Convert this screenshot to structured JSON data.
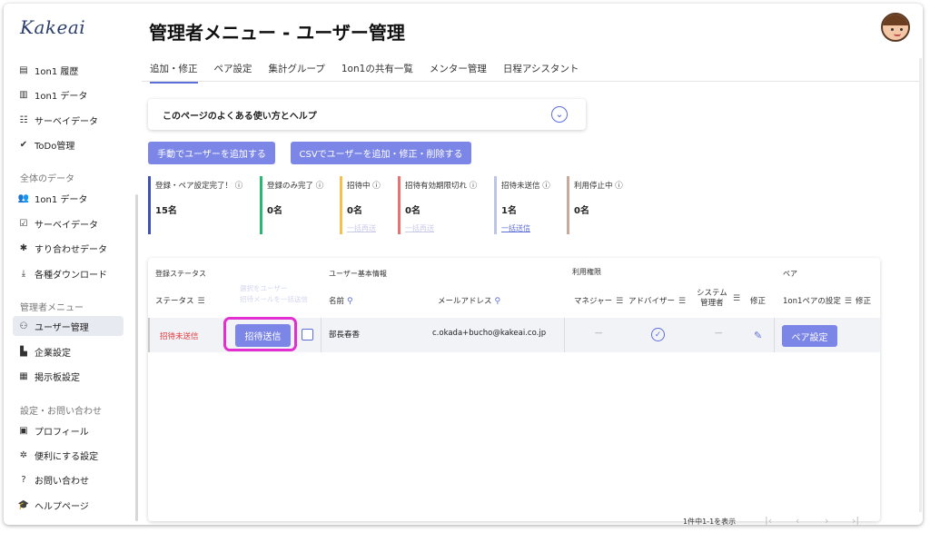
{
  "app": {
    "logo": "Kakeai"
  },
  "sidebar": {
    "items_top": [
      {
        "label": "1on1 履歴",
        "icon": "history-icon"
      },
      {
        "label": "1on1 データ",
        "icon": "chart-icon"
      },
      {
        "label": "サーベイデータ",
        "icon": "survey-icon"
      },
      {
        "label": "ToDo管理",
        "icon": "check-circle-icon"
      }
    ],
    "section_all": "全体のデータ",
    "items_all": [
      {
        "label": "1on1 データ",
        "icon": "people-icon"
      },
      {
        "label": "サーベイデータ",
        "icon": "calendar-check-icon"
      },
      {
        "label": "すり合わせデータ",
        "icon": "puzzle-icon"
      },
      {
        "label": "各種ダウンロード",
        "icon": "download-icon"
      }
    ],
    "section_admin": "管理者メニュー",
    "items_admin": [
      {
        "label": "ユーザー管理",
        "icon": "user-manage-icon",
        "active": true
      },
      {
        "label": "企業設定",
        "icon": "building-icon"
      },
      {
        "label": "掲示板設定",
        "icon": "board-icon"
      }
    ],
    "section_settings": "設定・お問い合わせ",
    "items_settings": [
      {
        "label": "プロフィール",
        "icon": "profile-icon"
      },
      {
        "label": "便利にする設定",
        "icon": "gear-icon"
      },
      {
        "label": "お問い合わせ",
        "icon": "question-icon"
      },
      {
        "label": "ヘルプページ",
        "icon": "graduation-cap-icon"
      }
    ]
  },
  "header": {
    "title": "管理者メニュー - ユーザー管理"
  },
  "tabs": [
    "追加・修正",
    "ペア設定",
    "集計グループ",
    "1on1の共有一覧",
    "メンター管理",
    "日程アシスタント"
  ],
  "help": {
    "label": "このページのよくある使い方とヘルプ"
  },
  "actions": {
    "add_manual": "手動でユーザーを追加する",
    "csv": "CSVでユーザーを追加・修正・削除する"
  },
  "stats": [
    {
      "label": "登録・ペア設定完了！ ⓘ",
      "value": "15名",
      "link": "",
      "color": "#3f51b5"
    },
    {
      "label": "登録のみ完了 ⓘ",
      "value": "0名",
      "link": "",
      "color": "#2bb673"
    },
    {
      "label": "招待中 ⓘ",
      "value": "0名",
      "link": "一括再送",
      "color": "#f2c14e"
    },
    {
      "label": "招待有効期限切れ ⓘ",
      "value": "0名",
      "link": "一括再送",
      "color": "#e57373"
    },
    {
      "label": "招待未送信 ⓘ",
      "value": "1名",
      "link": "一括送信",
      "color": "#bcc5e8"
    },
    {
      "label": "利用停止中 ⓘ",
      "value": "0名",
      "link": "",
      "color": "#c9a99a"
    }
  ],
  "table": {
    "group_status": "登録ステータス",
    "group_basic": "ユーザー基本情報",
    "group_perm": "利用権限",
    "group_pair": "ペア",
    "col_status": "ステータス",
    "faded_1": "選択をユーザー",
    "faded_2": "招待メールを一括送信",
    "col_name": "名前",
    "col_email": "メールアドレス",
    "col_manager": "マネジャー",
    "col_advisor": "アドバイザー",
    "col_system_1": "システム",
    "col_system_2": "管理者",
    "col_edit": "修正",
    "col_pair": "1on1ペアの設定",
    "col_pair_edit": "修正",
    "row": {
      "status": "招待未送信",
      "invite_button": "招待送信",
      "name": "部長春香",
      "email": "c.okada+bucho@kakeai.co.jp",
      "manager": "—",
      "system": "—",
      "pair_button": "ペア設定"
    }
  },
  "footer": {
    "range": "1件中1-1を表示"
  },
  "colors": {
    "accent": "#7b86e6",
    "highlight": "#e22fd1",
    "status_red": "#e0393e"
  }
}
